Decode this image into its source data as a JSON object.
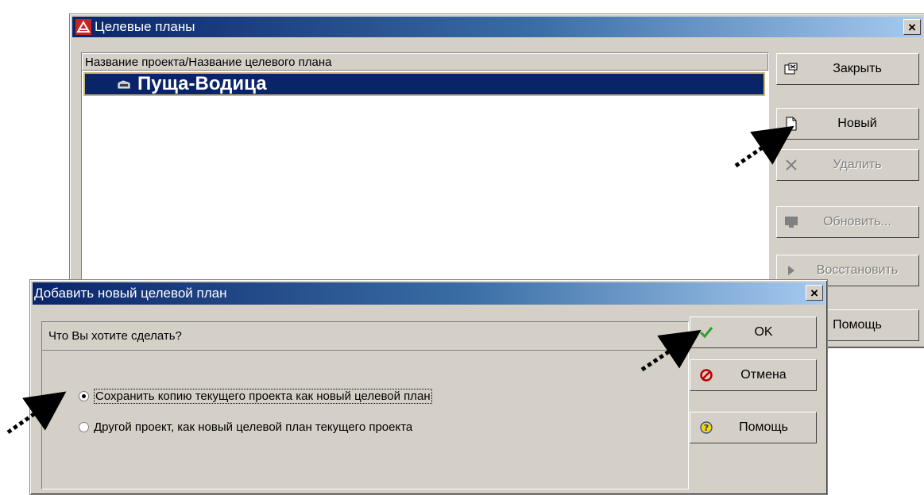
{
  "main_window": {
    "title": "Целевые планы",
    "list": {
      "header": "Название проекта/Название целевого плана",
      "rows": [
        {
          "label": "Пуща-Водица",
          "selected": true
        }
      ]
    },
    "buttons": {
      "close": "Закрыть",
      "new": "Новый",
      "delete": "Удалить",
      "update": "Обновить...",
      "restore": "Восстановить",
      "help": "Помощь"
    },
    "close_glyph": "×"
  },
  "dialog": {
    "title": "Добавить новый целевой план",
    "question": "Что Вы хотите сделать?",
    "options": [
      {
        "label": "Сохранить копию текущего проекта как новый целевой план",
        "selected": true
      },
      {
        "label": "Другой проект, как новый целевой план текущего проекта",
        "selected": false
      }
    ],
    "buttons": {
      "ok": "OK",
      "cancel": "Отмена",
      "help": "Помощь"
    },
    "close_glyph": "×"
  },
  "colors": {
    "title_gradient_start": "#0a246a",
    "title_gradient_end": "#a6caf0",
    "selection": "#0a246a",
    "window_face": "#d4d0c8"
  },
  "icons": {
    "app": "app-logo-icon",
    "project": "folder-icon",
    "close": "close-window-icon",
    "new": "new-document-icon",
    "delete": "delete-x-icon",
    "update": "monitor-icon",
    "restore": "play-arrow-icon",
    "ok": "checkmark-icon",
    "cancel": "cancel-icon",
    "help": "help-question-icon"
  }
}
